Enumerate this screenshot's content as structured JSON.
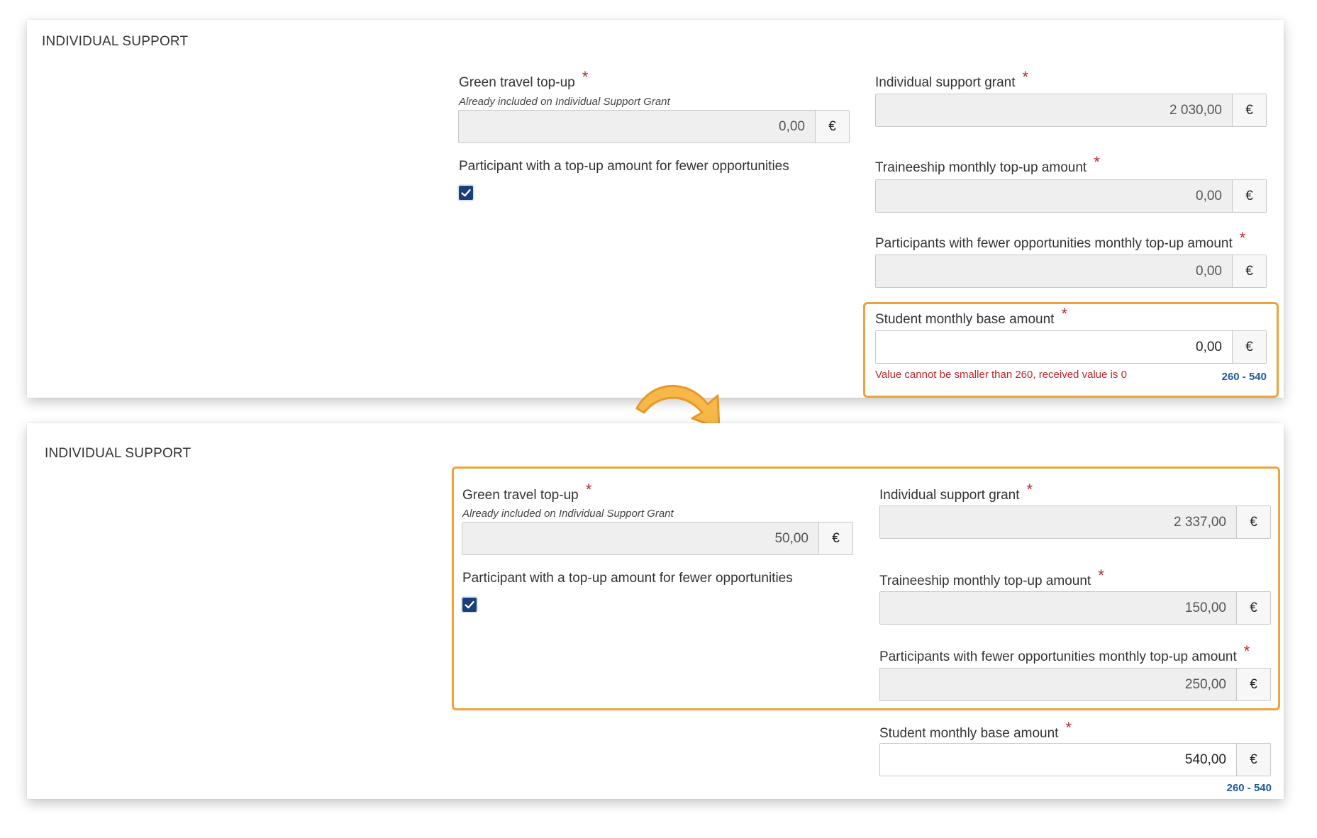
{
  "accent_color": "#f0a23a",
  "error_color": "#c0262d",
  "range_color": "#1f5a9a",
  "checkbox_color": "#173f7a",
  "before": {
    "section_title": "INDIVIDUAL SUPPORT",
    "green_travel": {
      "label": "Green travel top-up",
      "hint": "Already included on Individual Support Grant",
      "value": "0,00",
      "unit": "€"
    },
    "fewer_opportunities_checkbox": {
      "label": "Participant with a top-up amount for fewer opportunities",
      "checked": true
    },
    "individual_support_grant": {
      "label": "Individual support grant",
      "value": "2 030,00",
      "unit": "€"
    },
    "traineeship_topup": {
      "label": "Traineeship monthly top-up amount",
      "value": "0,00",
      "unit": "€"
    },
    "fewer_opportunities_topup": {
      "label": "Participants with fewer opportunities monthly top-up amount",
      "value": "0,00",
      "unit": "€"
    },
    "student_base": {
      "label": "Student monthly base amount",
      "value": "0,00",
      "unit": "€",
      "error": "Value cannot be smaller than 260, received value is 0",
      "range": "260 - 540"
    },
    "required_mark": "*"
  },
  "after": {
    "section_title": "INDIVIDUAL SUPPORT",
    "green_travel": {
      "label": "Green travel top-up",
      "hint": "Already included on Individual Support Grant",
      "value": "50,00",
      "unit": "€"
    },
    "fewer_opportunities_checkbox": {
      "label": "Participant with a top-up amount for fewer opportunities",
      "checked": true
    },
    "individual_support_grant": {
      "label": "Individual support grant",
      "value": "2 337,00",
      "unit": "€"
    },
    "traineeship_topup": {
      "label": "Traineeship monthly top-up amount",
      "value": "150,00",
      "unit": "€"
    },
    "fewer_opportunities_topup": {
      "label": "Participants with fewer opportunities monthly top-up amount",
      "value": "250,00",
      "unit": "€"
    },
    "student_base": {
      "label": "Student monthly base amount",
      "value": "540,00",
      "unit": "€",
      "range": "260 - 540"
    },
    "required_mark": "*"
  },
  "icons": {
    "transition_arrow": "curved-arrow-icon",
    "checkbox_check": "checkmark-icon"
  }
}
